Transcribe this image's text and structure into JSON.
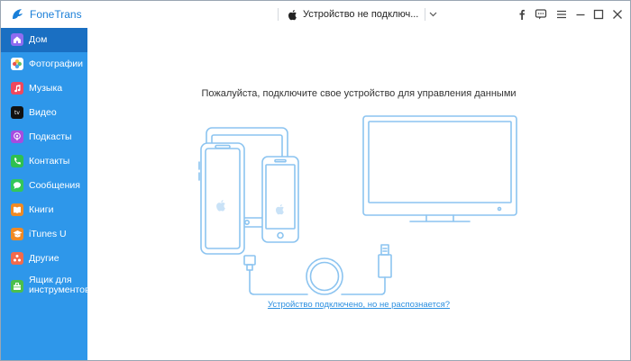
{
  "app": {
    "title": "FoneTrans",
    "device_selector": "Устройство не подключ..."
  },
  "titlebar_icons": [
    "facebook-icon",
    "feedback-icon",
    "menu-icon",
    "minimize-icon",
    "maximize-icon",
    "close-icon"
  ],
  "sidebar": {
    "items": [
      {
        "label": "Дом",
        "icon": "home-icon",
        "color": "#8e6cf0",
        "active": true
      },
      {
        "label": "Фотографии",
        "icon": "photos-icon",
        "color": "#ffffff",
        "active": false
      },
      {
        "label": "Музыка",
        "icon": "music-icon",
        "color": "#f0485d",
        "active": false
      },
      {
        "label": "Видео",
        "icon": "tv-icon",
        "color": "#111111",
        "active": false
      },
      {
        "label": "Подкасты",
        "icon": "podcasts-icon",
        "color": "#a64de0",
        "active": false
      },
      {
        "label": "Контакты",
        "icon": "phone-icon",
        "color": "#2fc050",
        "active": false
      },
      {
        "label": "Сообщения",
        "icon": "messages-icon",
        "color": "#34c759",
        "active": false
      },
      {
        "label": "Книги",
        "icon": "books-icon",
        "color": "#f08a24",
        "active": false
      },
      {
        "label": "iTunes U",
        "icon": "itunes-u-icon",
        "color": "#f08a24",
        "active": false
      },
      {
        "label": "Другие",
        "icon": "other-icon",
        "color": "#f36a4c",
        "active": false
      },
      {
        "label_line1": "Ящик для",
        "label_line2": "инструментов",
        "icon": "toolbox-icon",
        "color": "#4cbf4c",
        "active": false
      }
    ]
  },
  "main": {
    "title": "Пожалуйста, подключите свое устройство для управления данными",
    "help_link": "Устройство подключено, но не распознается?"
  },
  "colors": {
    "sidebar_bg": "#2e97ea",
    "sidebar_active": "#1a6fc2",
    "accent": "#1a7fd8",
    "illustration_stroke": "#8cc4f0"
  }
}
